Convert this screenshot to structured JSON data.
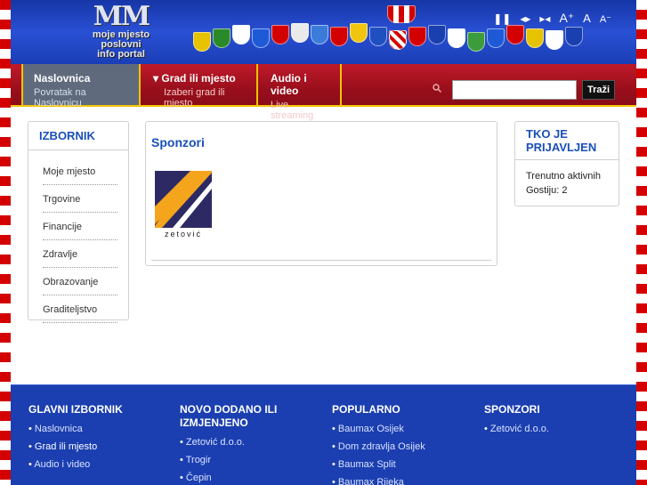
{
  "header": {
    "logo_lines": [
      "MM",
      "moje mjesto",
      "poslovni",
      "info portal"
    ],
    "font_tools": [
      "❚❚",
      "◂▸",
      "▸◂",
      "A⁺",
      "A",
      "A⁻"
    ]
  },
  "nav": {
    "items": [
      {
        "title": "Naslovnica",
        "subtitle": "Povratak na Naslovnicu"
      },
      {
        "title": "▾ Grad ili mjesto",
        "subtitle": "Izaberi grad ili mjesto"
      },
      {
        "title": "Audio i video",
        "subtitle": "Live streaming"
      }
    ],
    "search_placeholder": "",
    "search_button": "Traži"
  },
  "sidebar": {
    "title": "IZBORNIK",
    "items": [
      "Moje mjesto",
      "Trgovine",
      "Financije",
      "Zdravlje",
      "Obrazovanje",
      "Graditeljstvo"
    ]
  },
  "main": {
    "title": "Sponzori",
    "sponsor_logo_caption": "zetović"
  },
  "who": {
    "title_line1": "TKO JE",
    "title_line2": "PRIJAVLJEN",
    "text": "Trenutno aktivnih Gostiju: 2"
  },
  "footer": {
    "cols": [
      {
        "title": "GLAVNI IZBORNIK",
        "items": [
          "Naslovnica",
          "Grad ili mjesto",
          "Audio i video"
        ]
      },
      {
        "title_line1": "NOVO DODANO ILI",
        "title_line2": "IZMJENJENO",
        "items": [
          "Zetović d.o.o.",
          "Trogir",
          "Čepin"
        ]
      },
      {
        "title": "POPULARNO",
        "items": [
          "Baumax Osijek",
          "Dom zdravlja Osijek",
          "Baumax Split",
          "Baumax Rijeka"
        ]
      },
      {
        "title": "SPONZORI",
        "items": [
          "Zetović d.o.o."
        ]
      }
    ]
  },
  "colors": {
    "nav_red": "#9a0f1c",
    "accent_yellow": "#f3c400",
    "footer_blue": "#1b3fb0",
    "title_blue": "#1a4fb8"
  }
}
